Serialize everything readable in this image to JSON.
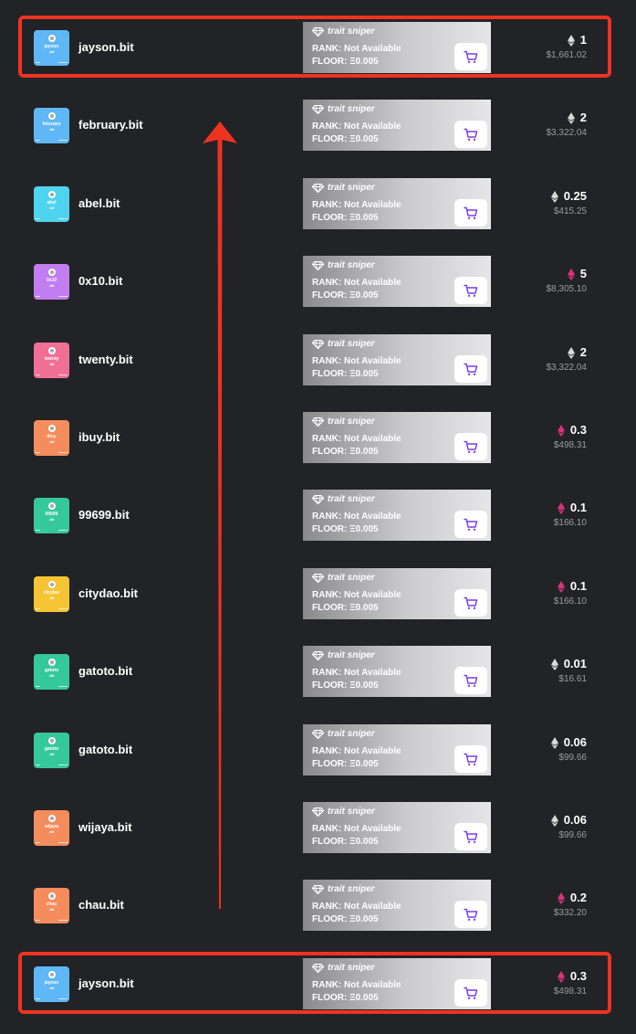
{
  "colors": {
    "background": "#222326",
    "highlight": "#ee3322",
    "cart_icon": "#7b3fe4",
    "eth_gray": "#d8d8d8",
    "eth_pink": "#d6337d"
  },
  "icons": {
    "gem": "gem-icon",
    "cart": "cart-icon",
    "eth": "eth-icon"
  },
  "trait_sniper": {
    "brand": "trait sniper",
    "rank_label": "RANK:",
    "rank_value": "Not Available",
    "floor_label": "FLOOR:",
    "floor_value": "Ξ0.005"
  },
  "rows": [
    {
      "name": "jayson.bit",
      "thumb_name": "jayson",
      "tld": ".bit",
      "thumb_color": "#5fb7f5",
      "eth": "1",
      "usd": "$1,661.02",
      "eth_color": "gray"
    },
    {
      "name": "february.bit",
      "thumb_name": "february",
      "tld": ".bit",
      "thumb_color": "#5fb7f5",
      "eth": "2",
      "usd": "$3,322.04",
      "eth_color": "gray"
    },
    {
      "name": "abel.bit",
      "thumb_name": "abel",
      "tld": ".bit",
      "thumb_color": "#4fd4ef",
      "eth": "0.25",
      "usd": "$415.25",
      "eth_color": "gray"
    },
    {
      "name": "0x10.bit",
      "thumb_name": "0x10",
      "tld": ".bit",
      "thumb_color": "#c07ef0",
      "eth": "5",
      "usd": "$8,305.10",
      "eth_color": "pink"
    },
    {
      "name": "twenty.bit",
      "thumb_name": "twenty",
      "tld": ".bit",
      "thumb_color": "#f06f95",
      "eth": "2",
      "usd": "$3,322.04",
      "eth_color": "gray"
    },
    {
      "name": "ibuy.bit",
      "thumb_name": "ibuy",
      "tld": ".bit",
      "thumb_color": "#f58c5e",
      "eth": "0.3",
      "usd": "$498.31",
      "eth_color": "pink"
    },
    {
      "name": "99699.bit",
      "thumb_name": "99699",
      "tld": ".bit",
      "thumb_color": "#35c99a",
      "eth": "0.1",
      "usd": "$166.10",
      "eth_color": "pink"
    },
    {
      "name": "citydao.bit",
      "thumb_name": "citydao",
      "tld": ".bit",
      "thumb_color": "#f4c435",
      "eth": "0.1",
      "usd": "$166.10",
      "eth_color": "pink"
    },
    {
      "name": "gatoto.bit",
      "thumb_name": "gatoto",
      "tld": ".bit",
      "thumb_color": "#35c99a",
      "eth": "0.01",
      "usd": "$16.61",
      "eth_color": "gray"
    },
    {
      "name": "gatoto.bit",
      "thumb_name": "gatoto",
      "tld": ".bit",
      "thumb_color": "#35c99a",
      "eth": "0.06",
      "usd": "$99.66",
      "eth_color": "gray"
    },
    {
      "name": "wijaya.bit",
      "thumb_name": "wijaya",
      "tld": ".bit",
      "thumb_color": "#f58c5e",
      "eth": "0.06",
      "usd": "$99.66",
      "eth_color": "gray"
    },
    {
      "name": "chau.bit",
      "thumb_name": "chau",
      "tld": ".bit",
      "thumb_color": "#f58c5e",
      "eth": "0.2",
      "usd": "$332.20",
      "eth_color": "pink"
    },
    {
      "name": "jayson.bit",
      "thumb_name": "jayson",
      "tld": ".bit",
      "thumb_color": "#5fb7f5",
      "eth": "0.3",
      "usd": "$498.31",
      "eth_color": "pink"
    }
  ],
  "highlighted_rows": [
    0,
    12
  ]
}
